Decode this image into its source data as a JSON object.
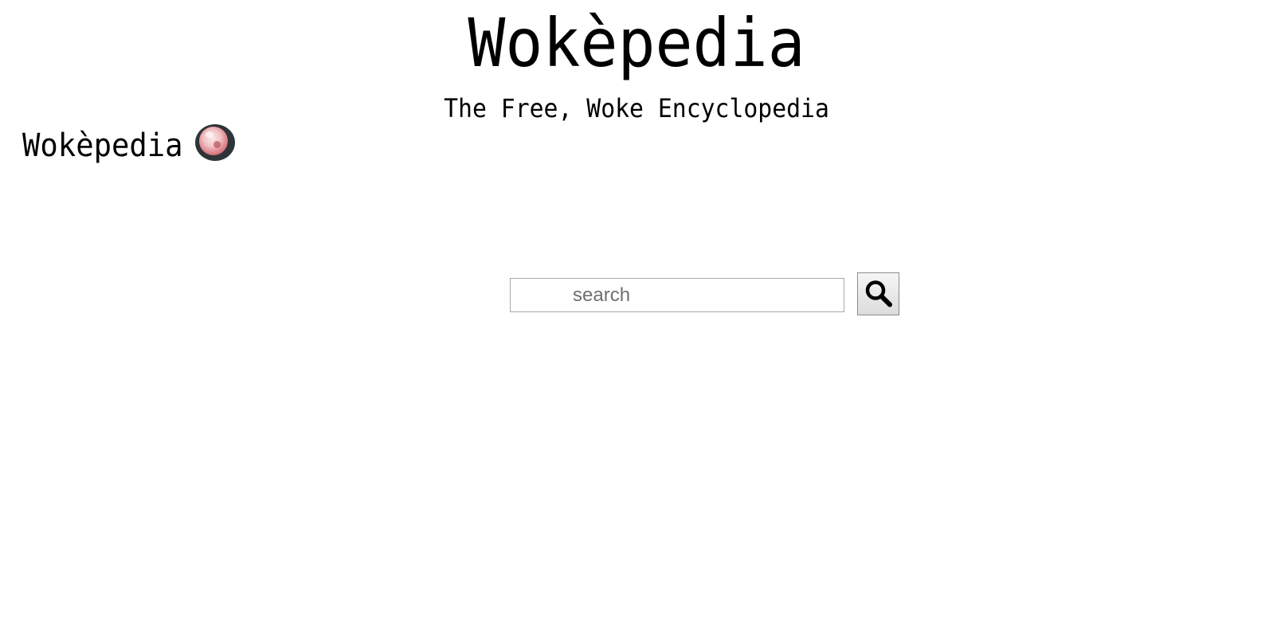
{
  "header": {
    "title": "Wokèpedia",
    "tagline": "The Free, Woke Encyclopedia"
  },
  "logo": {
    "text": "Wokèpedia",
    "badge_icon": "globe-badge-icon"
  },
  "search": {
    "placeholder": "search",
    "value": "",
    "button_icon": "magnifier-icon"
  },
  "colors": {
    "background": "#ffffff",
    "text": "#000000",
    "input_border": "#a9a9a9",
    "placeholder": "#6f6f6f",
    "badge_ring": "#2f3438"
  }
}
